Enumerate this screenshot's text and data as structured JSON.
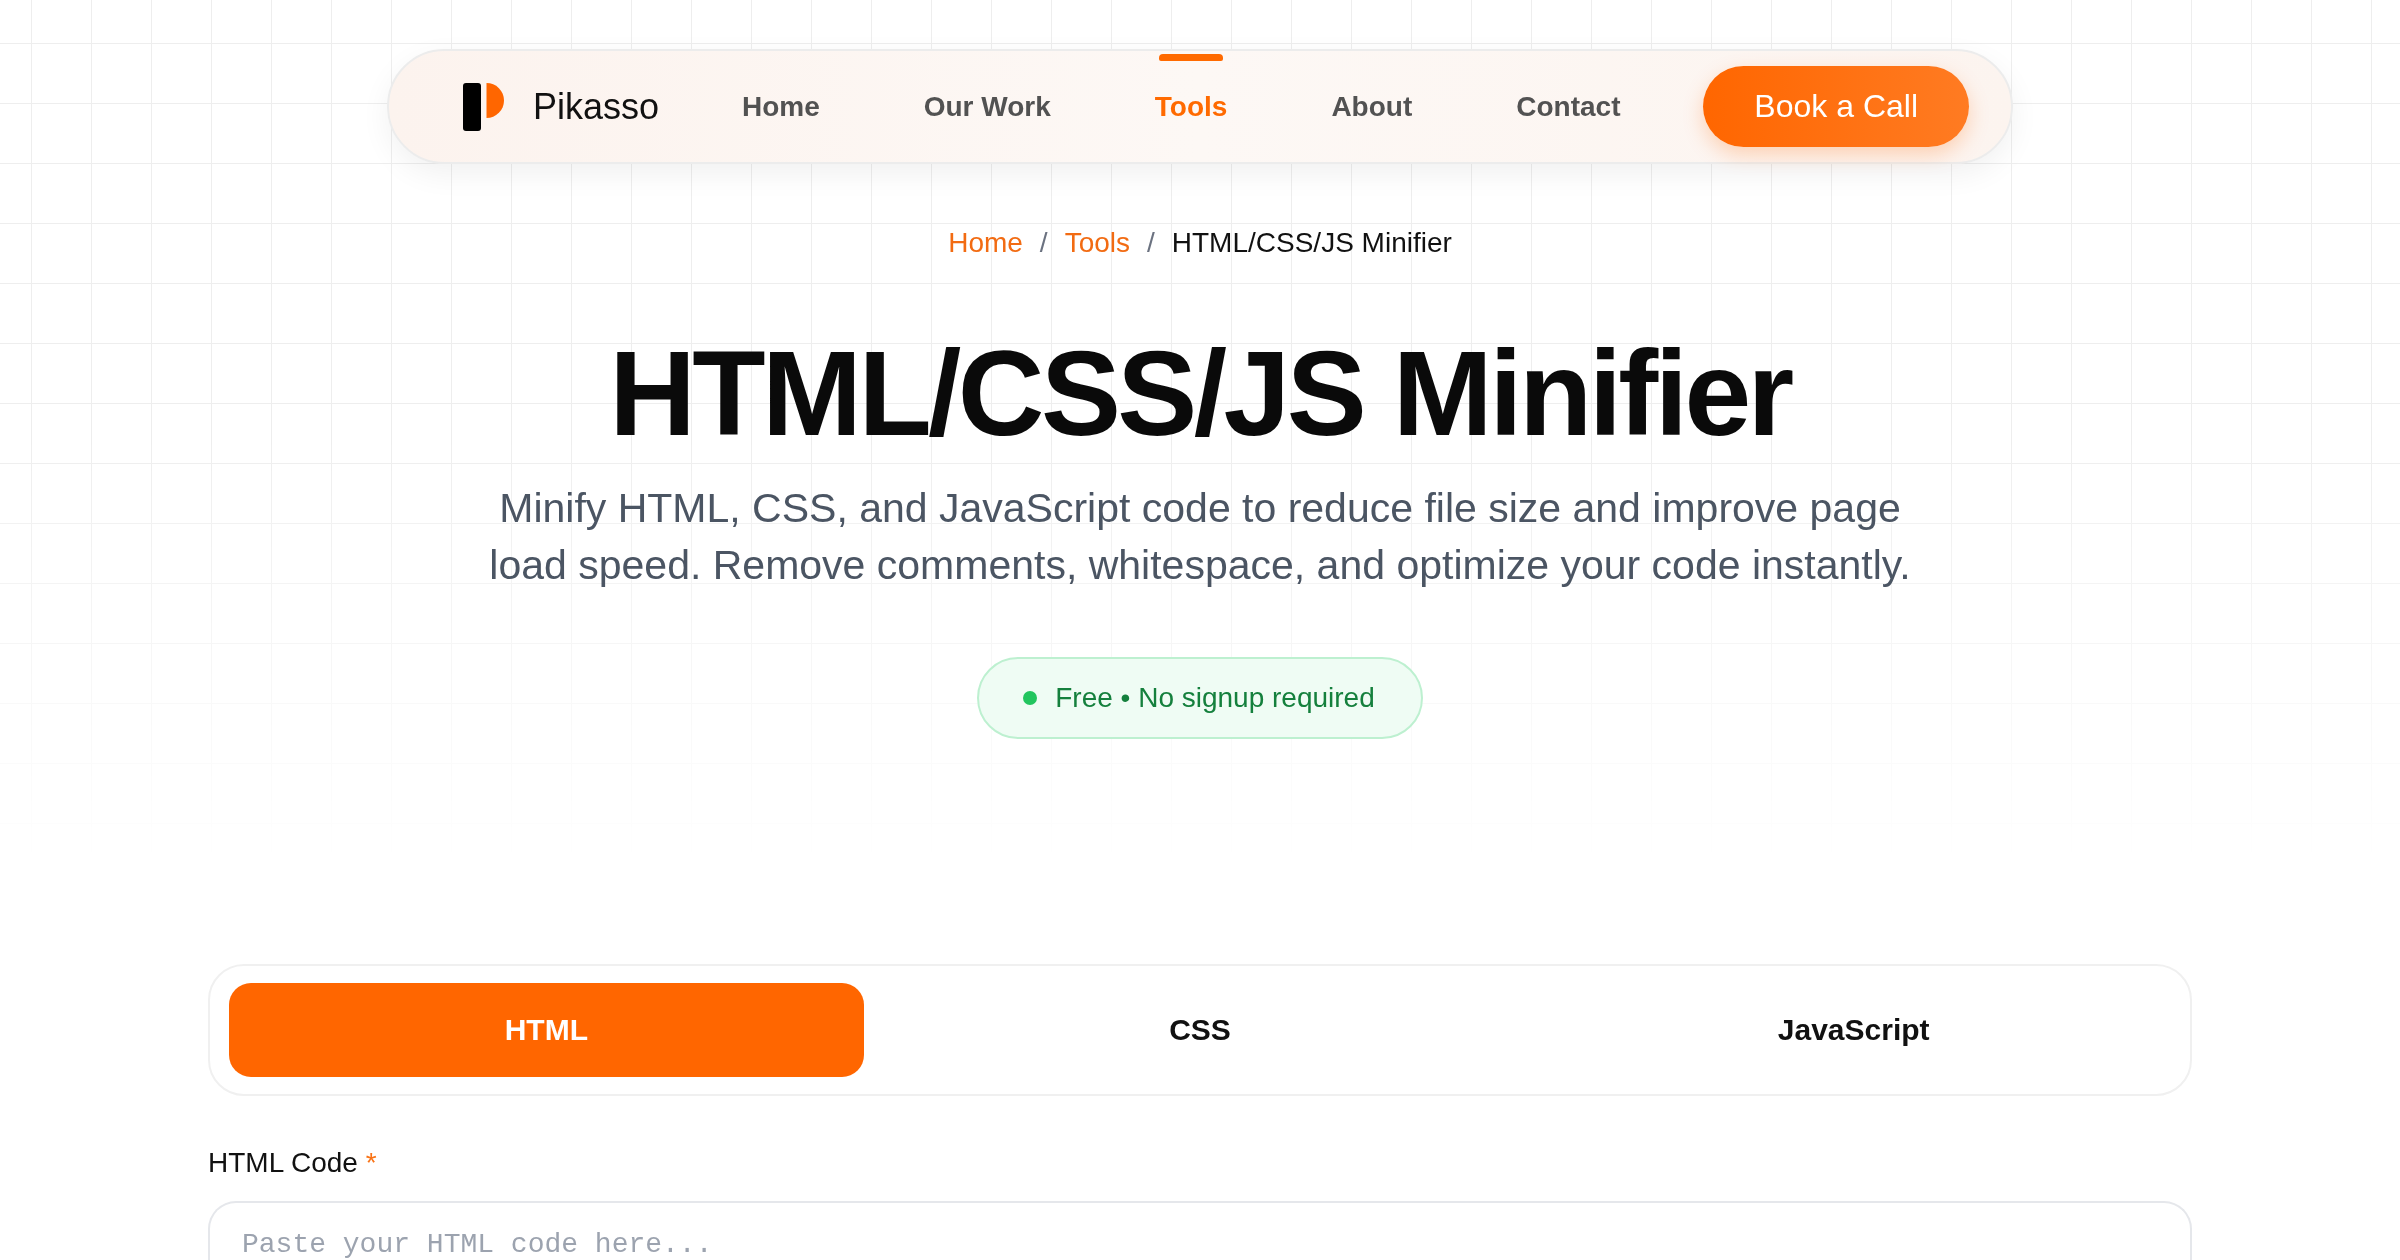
{
  "nav": {
    "brand": "Pikasso",
    "links": [
      {
        "label": "Home",
        "selected": false
      },
      {
        "label": "Our Work",
        "selected": false
      },
      {
        "label": "Tools",
        "selected": true
      },
      {
        "label": "About",
        "selected": false
      },
      {
        "label": "Contact",
        "selected": false
      }
    ],
    "cta": "Book a Call"
  },
  "breadcrumb": [
    {
      "kind": "link",
      "label": "Home"
    },
    {
      "kind": "link",
      "separator": "/",
      "label": "Tools"
    },
    {
      "kind": "current",
      "separator": "/",
      "label": "HTML/CSS/JS Minifier"
    }
  ],
  "title": "HTML/CSS/JS Minifier",
  "description": "Minify HTML, CSS, and JavaScript code to reduce file size and improve page load speed. Remove comments, whitespace, and optimize your code instantly.",
  "badge": {
    "text": "Free • No signup required"
  },
  "tabs": [
    {
      "label": "HTML",
      "selected": true
    },
    {
      "label": "CSS",
      "selected": false
    },
    {
      "label": "JavaScript",
      "selected": false
    }
  ],
  "field": {
    "label": "HTML Code",
    "required_mark": "*",
    "placeholder": "Paste your HTML code here..."
  }
}
